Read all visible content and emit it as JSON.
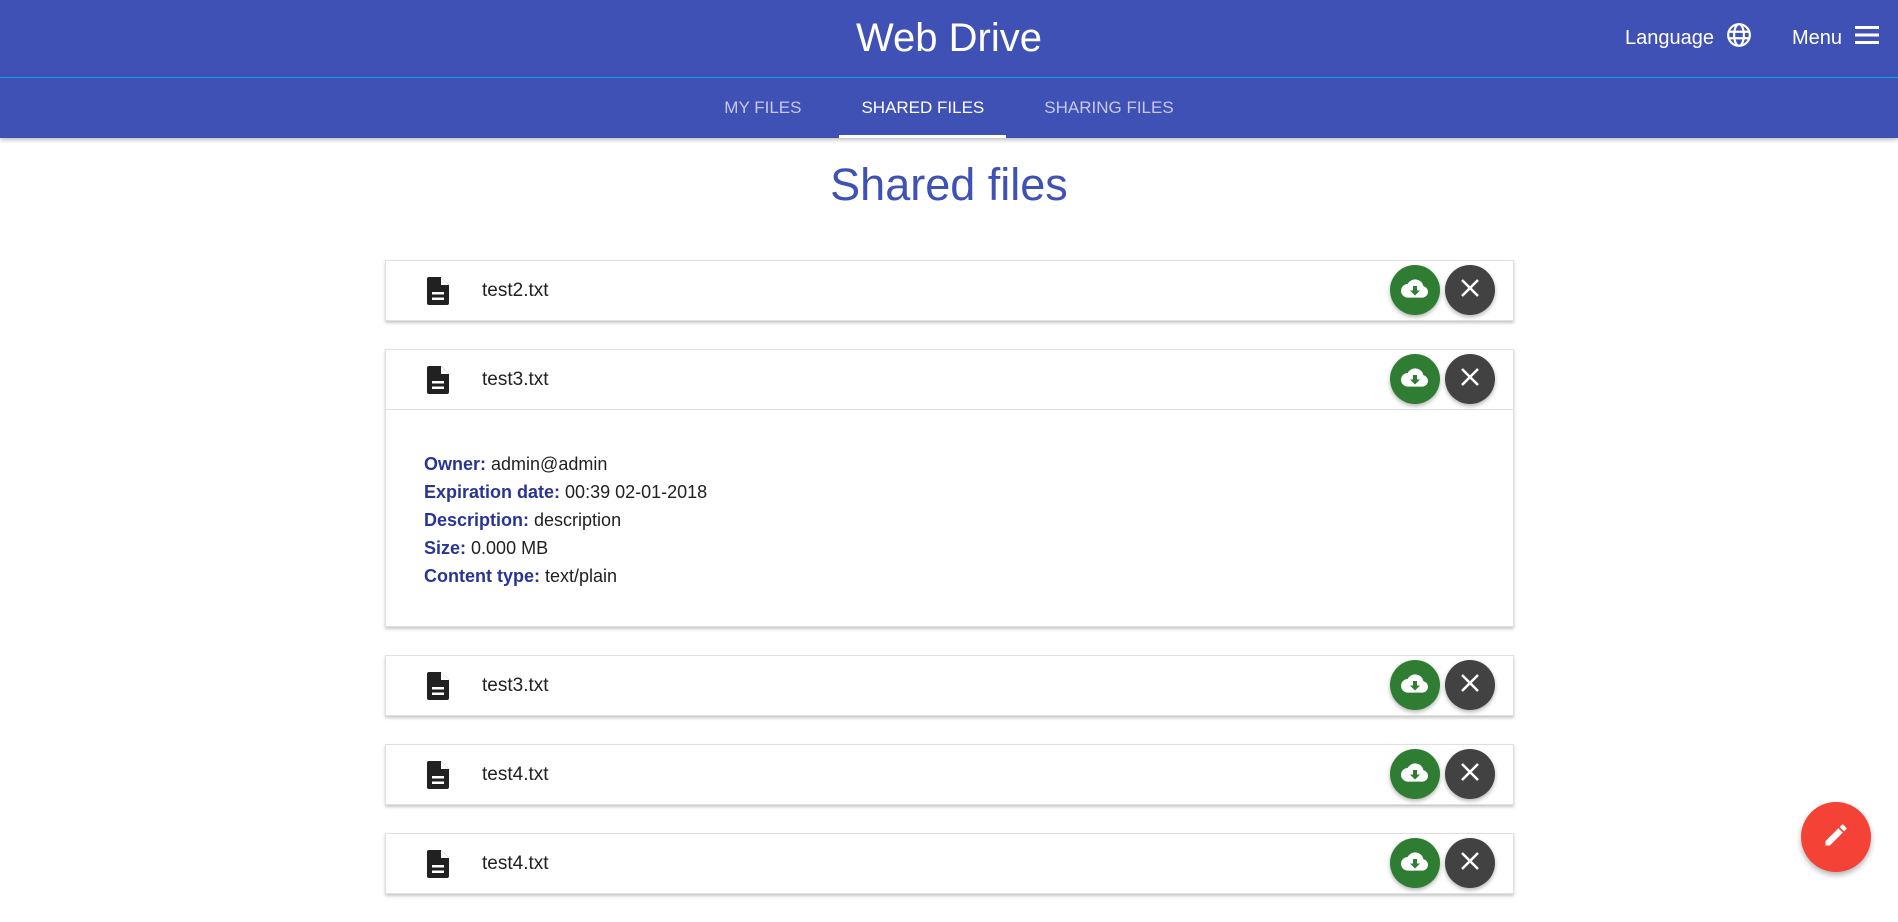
{
  "app": {
    "title": "Web Drive"
  },
  "header_actions": {
    "language_label": "Language",
    "language_icon": "globe-icon",
    "menu_label": "Menu",
    "menu_icon": "hamburger-menu-icon"
  },
  "tabs": [
    {
      "label": "MY FILES",
      "active": false
    },
    {
      "label": "SHARED FILES",
      "active": true
    },
    {
      "label": "SHARING FILES",
      "active": false
    }
  ],
  "page": {
    "title": "Shared files"
  },
  "files": [
    {
      "name": "test2.txt",
      "expanded": false
    },
    {
      "name": "test3.txt",
      "expanded": true,
      "details": {
        "owner_label": "Owner:",
        "owner": "admin@admin",
        "expiration_label": "Expiration date:",
        "expiration": "00:39 02-01-2018",
        "description_label": "Description:",
        "description": "description",
        "size_label": "Size:",
        "size": "0.000 MB",
        "content_type_label": "Content type:",
        "content_type": "text/plain"
      }
    },
    {
      "name": "test3.txt",
      "expanded": false
    },
    {
      "name": "test4.txt",
      "expanded": false
    },
    {
      "name": "test4.txt",
      "expanded": false
    }
  ],
  "icons": {
    "file": "file-document-icon",
    "download": "cloud-download-icon",
    "remove": "close-icon",
    "edit": "pencil-icon"
  },
  "colors": {
    "primary": "#3f51b5",
    "accent_line": "#03a9f4",
    "download": "#2e7d32",
    "remove": "#424242",
    "edit_fab": "#f44336",
    "detail_label": "#283593"
  }
}
